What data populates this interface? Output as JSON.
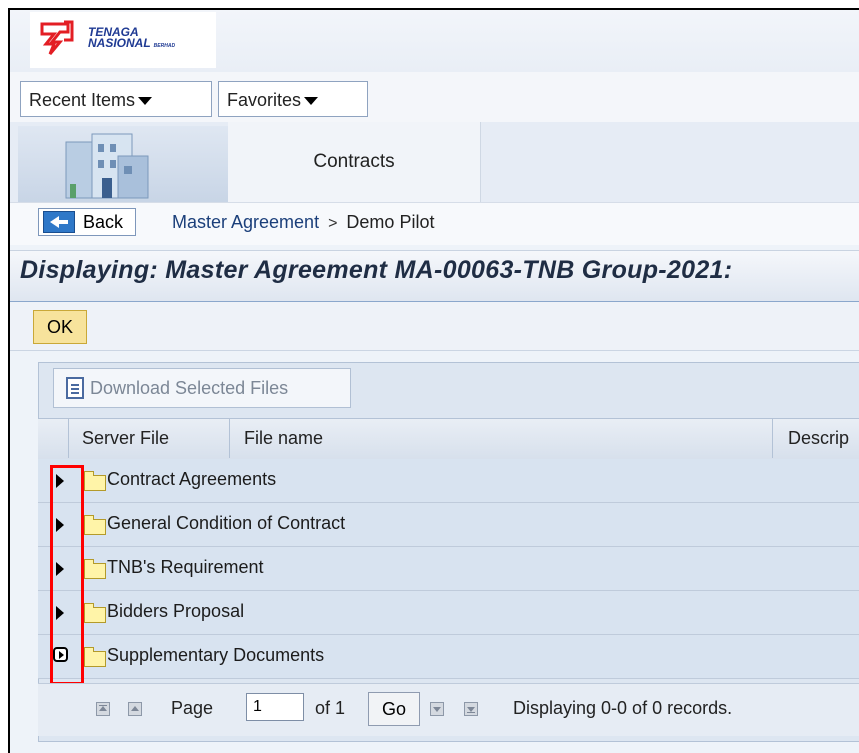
{
  "logo": {
    "line1": "TENAGA",
    "line2": "NASIONAL",
    "line3": "BERHAD",
    "color": "#1f3a93",
    "accent": "#e31e24"
  },
  "menu": {
    "recent_items": "Recent Items",
    "favorites": "Favorites"
  },
  "tabs": {
    "contracts": "Contracts"
  },
  "breadcrumb": {
    "back_label": "Back",
    "parent": "Master Agreement",
    "separator": ">",
    "current": "Demo Pilot"
  },
  "page": {
    "title": "Displaying: Master Agreement MA-00063-TNB Group-2021:"
  },
  "actions": {
    "ok_label": "OK",
    "download_label": "Download Selected Files"
  },
  "table": {
    "headers": [
      "Server File",
      "File name",
      "Descrip"
    ],
    "rows": [
      {
        "label": "Contract Agreements"
      },
      {
        "label": "General Condition of Contract"
      },
      {
        "label": "TNB's Requirement"
      },
      {
        "label": "Bidders Proposal"
      },
      {
        "label": "Supplementary Documents"
      }
    ]
  },
  "pager": {
    "page_label": "Page",
    "page_value": "1",
    "of_label": "of 1",
    "go_label": "Go",
    "status": "Displaying 0-0 of 0 records."
  },
  "colors": {
    "highlight": "#ff0000",
    "ok_button": "#f7e39c",
    "row_bg": "#d8e3f0"
  }
}
